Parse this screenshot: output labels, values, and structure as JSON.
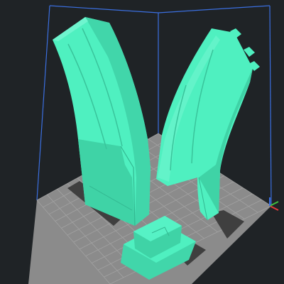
{
  "viewport": {
    "background_color": "#1f2326",
    "bounding_box_color": "#3b6fe0",
    "build_plate_color": "#8b8b8b",
    "grid_line_color": "#a2a2a2",
    "model_color": "#4ff0c0",
    "model_shadow_color": "#36b894",
    "shadow_color": "#3f3f3f",
    "axis_colors": {
      "x": "#e23b3b",
      "y": "#3fbf3f",
      "z": "#3b6fe0"
    }
  },
  "models": [
    {
      "name": "magazine-half-left"
    },
    {
      "name": "magazine-half-right"
    },
    {
      "name": "base-plug"
    }
  ]
}
